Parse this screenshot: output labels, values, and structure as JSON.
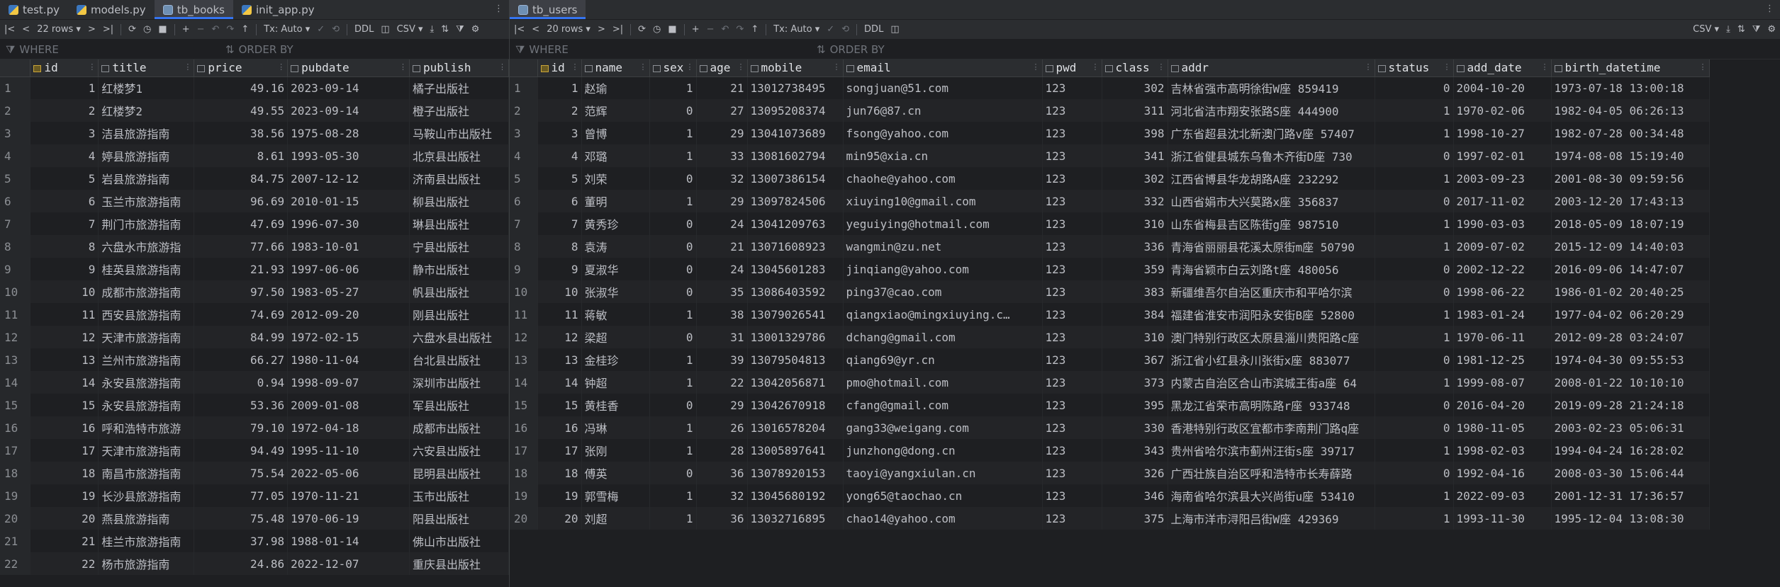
{
  "left": {
    "tabs": [
      {
        "label": "test.py",
        "kind": "py"
      },
      {
        "label": "models.py",
        "kind": "py"
      },
      {
        "label": "tb_books",
        "kind": "tbl",
        "active": true
      },
      {
        "label": "init_app.py",
        "kind": "py"
      }
    ],
    "tab_more": "⋮",
    "toolbar": {
      "rows_label": "22 rows",
      "tx_label": "Tx: Auto",
      "ddl_label": "DDL",
      "export_label": "CSV"
    },
    "filter": {
      "where": "WHERE",
      "order_by": "ORDER BY"
    },
    "columns": [
      "id",
      "title",
      "price",
      "pubdate",
      "publish"
    ],
    "rows": [
      [
        "1",
        "红楼梦1",
        "49.16",
        "2023-09-14",
        "橘子出版社"
      ],
      [
        "2",
        "红楼梦2",
        "49.55",
        "2023-09-14",
        "橙子出版社"
      ],
      [
        "3",
        "洁县旅游指南",
        "38.56",
        "1975-08-28",
        "马鞍山市出版社"
      ],
      [
        "4",
        "婷县旅游指南",
        "8.61",
        "1993-05-30",
        "北京县出版社"
      ],
      [
        "5",
        "岩县旅游指南",
        "84.75",
        "2007-12-12",
        "济南县出版社"
      ],
      [
        "6",
        "玉兰市旅游指南",
        "96.69",
        "2010-01-15",
        "柳县出版社"
      ],
      [
        "7",
        "荆门市旅游指南",
        "47.69",
        "1996-07-30",
        "琳县出版社"
      ],
      [
        "8",
        "六盘水市旅游指",
        "77.66",
        "1983-10-01",
        "宁县出版社"
      ],
      [
        "9",
        "桂英县旅游指南",
        "21.93",
        "1997-06-06",
        "静市出版社"
      ],
      [
        "10",
        "成都市旅游指南",
        "97.50",
        "1983-05-27",
        "帆县出版社"
      ],
      [
        "11",
        "西安县旅游指南",
        "74.69",
        "2012-09-20",
        "刚县出版社"
      ],
      [
        "12",
        "天津市旅游指南",
        "84.99",
        "1972-02-15",
        "六盘水县出版社"
      ],
      [
        "13",
        "兰州市旅游指南",
        "66.27",
        "1980-11-04",
        "台北县出版社"
      ],
      [
        "14",
        "永安县旅游指南",
        "0.94",
        "1998-09-07",
        "深圳市出版社"
      ],
      [
        "15",
        "永安县旅游指南",
        "53.36",
        "2009-01-08",
        "军县出版社"
      ],
      [
        "16",
        "呼和浩特市旅游",
        "79.10",
        "1972-04-18",
        "成都市出版社"
      ],
      [
        "17",
        "天津市旅游指南",
        "94.49",
        "1995-11-10",
        "六安县出版社"
      ],
      [
        "18",
        "南昌市旅游指南",
        "75.54",
        "2022-05-06",
        "昆明县出版社"
      ],
      [
        "19",
        "长沙县旅游指南",
        "77.05",
        "1970-11-21",
        "玉市出版社"
      ],
      [
        "20",
        "燕县旅游指南",
        "75.48",
        "1970-06-19",
        "阳县出版社"
      ],
      [
        "21",
        "桂兰市旅游指南",
        "37.98",
        "1988-01-14",
        "佛山市出版社"
      ],
      [
        "22",
        "杨市旅游指南",
        "24.86",
        "2022-12-07",
        "重庆县出版社"
      ]
    ]
  },
  "right": {
    "tabs": [
      {
        "label": "tb_users",
        "kind": "tbl",
        "active": true
      }
    ],
    "tab_more": "⋮",
    "toolbar": {
      "rows_label": "20 rows",
      "tx_label": "Tx: Auto",
      "ddl_label": "DDL",
      "export_label": "CSV"
    },
    "filter": {
      "where": "WHERE",
      "order_by": "ORDER BY"
    },
    "columns": [
      "id",
      "name",
      "sex",
      "age",
      "mobile",
      "email",
      "pwd",
      "class",
      "addr",
      "status",
      "add_date",
      "birth_datetime"
    ],
    "rows": [
      [
        "1",
        "赵瑜",
        "1",
        "21",
        "13012738495",
        "songjuan@51.com",
        "123",
        "302",
        "吉林省强市高明徐街W座 859419",
        "0",
        "2004-10-20",
        "1973-07-18 13:00:18"
      ],
      [
        "2",
        "范辉",
        "0",
        "27",
        "13095208374",
        "jun76@87.cn",
        "123",
        "311",
        "河北省洁市翔安张路S座 444900",
        "1",
        "1970-02-06",
        "1982-04-05 06:26:13"
      ],
      [
        "3",
        "曾博",
        "1",
        "29",
        "13041073689",
        "fsong@yahoo.com",
        "123",
        "398",
        "广东省超县沈北新澳门路v座 57407",
        "1",
        "1998-10-27",
        "1982-07-28 00:34:48"
      ],
      [
        "4",
        "邓璐",
        "1",
        "33",
        "13081602794",
        "min95@xia.cn",
        "123",
        "341",
        "浙江省健县城东乌鲁木齐街D座 730",
        "0",
        "1997-02-01",
        "1974-08-08 15:19:40"
      ],
      [
        "5",
        "刘荣",
        "0",
        "32",
        "13007386154",
        "chaohe@yahoo.com",
        "123",
        "302",
        "江西省博县华龙胡路A座 232292",
        "1",
        "2003-09-23",
        "2001-08-30 09:59:56"
      ],
      [
        "6",
        "董明",
        "1",
        "29",
        "13097824506",
        "xiuying10@gmail.com",
        "123",
        "332",
        "山西省娟市大兴莫路x座 356837",
        "0",
        "2017-11-02",
        "2003-12-20 17:43:13"
      ],
      [
        "7",
        "黄秀珍",
        "0",
        "24",
        "13041209763",
        "yeguiying@hotmail.com",
        "123",
        "310",
        "山东省梅县吉区陈街g座 987510",
        "1",
        "1990-03-03",
        "2018-05-09 18:07:19"
      ],
      [
        "8",
        "袁涛",
        "0",
        "21",
        "13071608923",
        "wangmin@zu.net",
        "123",
        "336",
        "青海省丽丽县花溪太原街m座 50790",
        "1",
        "2009-07-02",
        "2015-12-09 14:40:03"
      ],
      [
        "9",
        "夏淑华",
        "0",
        "24",
        "13045601283",
        "jinqiang@yahoo.com",
        "123",
        "359",
        "青海省颖市白云刘路t座 480056",
        "0",
        "2002-12-22",
        "2016-09-06 14:47:07"
      ],
      [
        "10",
        "张淑华",
        "0",
        "35",
        "13086403592",
        "ping37@cao.com",
        "123",
        "383",
        "新疆维吾尔自治区重庆市和平哈尔滨",
        "0",
        "1998-06-22",
        "1986-01-02 20:40:25"
      ],
      [
        "11",
        "蒋敏",
        "1",
        "38",
        "13079026541",
        "qiangxiao@mingxiuying.c…",
        "123",
        "384",
        "福建省淮安市润阳永安街B座 52800",
        "1",
        "1983-01-24",
        "1977-04-02 06:20:29"
      ],
      [
        "12",
        "梁超",
        "0",
        "31",
        "13001329786",
        "dchang@gmail.com",
        "123",
        "310",
        "澳门特别行政区太原县淄川贵阳路c座",
        "1",
        "1970-06-11",
        "2012-09-28 03:24:07"
      ],
      [
        "13",
        "金桂珍",
        "1",
        "39",
        "13079504813",
        "qiang69@yr.cn",
        "123",
        "367",
        "浙江省小红县永川张街x座 883077",
        "0",
        "1981-12-25",
        "1974-04-30 09:55:53"
      ],
      [
        "14",
        "钟超",
        "1",
        "22",
        "13042056871",
        "pmo@hotmail.com",
        "123",
        "373",
        "内蒙古自治区合山市滨城王街a座 64",
        "1",
        "1999-08-07",
        "2008-01-22 10:10:10"
      ],
      [
        "15",
        "黄桂香",
        "0",
        "29",
        "13042670918",
        "cfang@gmail.com",
        "123",
        "395",
        "黑龙江省荣市高明陈路r座 933748",
        "0",
        "2016-04-20",
        "2019-09-28 21:24:18"
      ],
      [
        "16",
        "冯琳",
        "1",
        "26",
        "13016578204",
        "gang33@weigang.com",
        "123",
        "330",
        "香港特别行政区宜都市李南荆门路q座",
        "0",
        "1980-11-05",
        "2003-02-23 05:06:31"
      ],
      [
        "17",
        "张刚",
        "1",
        "28",
        "13005897641",
        "junzhong@dong.cn",
        "123",
        "343",
        "贵州省哈尔滨市蓟州汪街s座 39717",
        "1",
        "1998-02-03",
        "1994-04-24 16:28:02"
      ],
      [
        "18",
        "傅英",
        "0",
        "36",
        "13078920153",
        "taoyi@yangxiulan.cn",
        "123",
        "326",
        "广西壮族自治区呼和浩特市长寿薛路",
        "0",
        "1992-04-16",
        "2008-03-30 15:06:44"
      ],
      [
        "19",
        "郭雪梅",
        "1",
        "32",
        "13045680192",
        "yong65@taochao.cn",
        "123",
        "346",
        "海南省哈尔滨县大兴尚街u座 53410",
        "1",
        "2022-09-03",
        "2001-12-31 17:36:57"
      ],
      [
        "20",
        "刘超",
        "1",
        "36",
        "13032716895",
        "chao14@yahoo.com",
        "123",
        "375",
        "上海市洋市浔阳吕街W座 429369",
        "1",
        "1993-11-30",
        "1995-12-04 13:08:30"
      ]
    ]
  }
}
